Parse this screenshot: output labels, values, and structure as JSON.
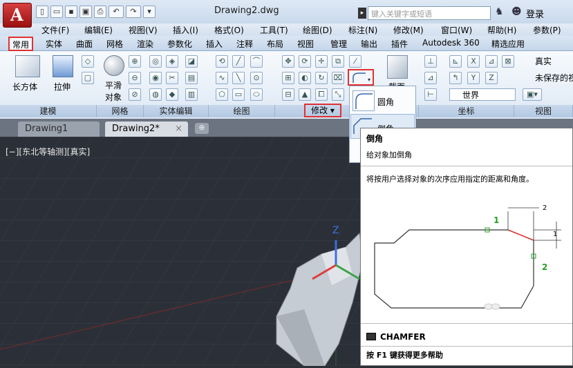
{
  "title_bar": {
    "document": "Drawing2.dwg",
    "search_placeholder": "键入关键字或短语",
    "login": "登录"
  },
  "menu": [
    "文件(F)",
    "编辑(E)",
    "视图(V)",
    "插入(I)",
    "格式(O)",
    "工具(T)",
    "绘图(D)",
    "标注(N)",
    "修改(M)",
    "窗口(W)",
    "帮助(H)",
    "参数(P)"
  ],
  "ribbon_tabs": [
    "常用",
    "实体",
    "曲面",
    "网格",
    "渲染",
    "参数化",
    "插入",
    "注释",
    "布局",
    "视图",
    "管理",
    "输出",
    "插件",
    "Autodesk 360",
    "精选应用"
  ],
  "ribbon": {
    "box_label": "长方体",
    "extrude_label": "拉伸",
    "smooth_label_1": "平滑",
    "smooth_label_2": "对象",
    "section_label": "截面",
    "visual_style": "真实",
    "view_state": "未保存的视",
    "ucs": "世界",
    "panels": [
      "建模",
      "网格",
      "实体编辑",
      "绘图",
      "修改",
      "坐标",
      "视图"
    ]
  },
  "doc_tabs": [
    "Drawing1",
    "Drawing2*"
  ],
  "viewport_label": "[−][东北等轴测][真实]",
  "flyout": {
    "fillet": "圆角",
    "chamfer": "倒角"
  },
  "tooltip": {
    "title": "倒角",
    "subtitle": "给对象加倒角",
    "description": "将按用户选择对象的次序应用指定的距离和角度。",
    "dim_top": "2",
    "dim_right": "1",
    "mark1": "1",
    "mark2": "2",
    "command": "CHAMFER",
    "help": "按 F1 键获得更多帮助"
  },
  "colors": {
    "accent_red": "#e03030",
    "axis_z": "#3b6fe0",
    "axis_x": "#e03a3a",
    "axis_y": "#3aa34a",
    "mark_green": "#22a022"
  }
}
